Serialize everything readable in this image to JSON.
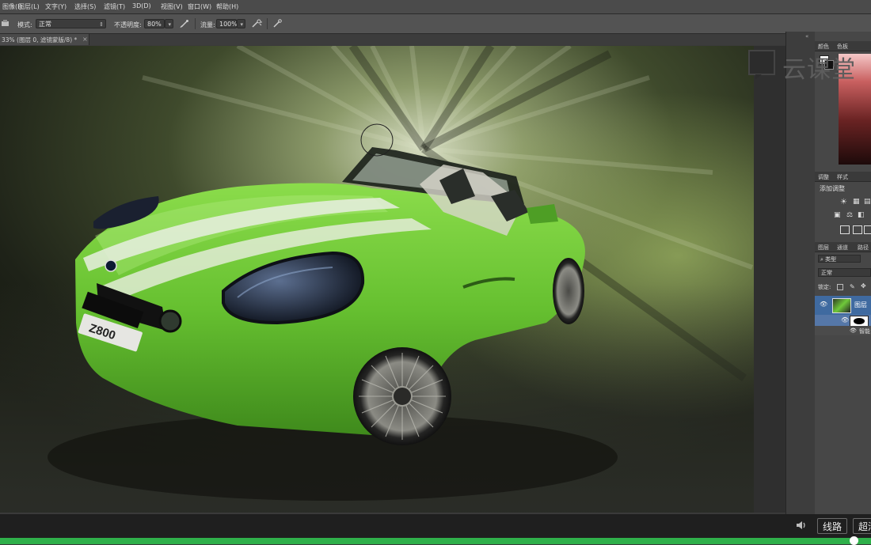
{
  "menu": {
    "items": [
      "图像(I)",
      "图层(L)",
      "文字(Y)",
      "选择(S)",
      "滤镜(T)",
      "3D(D)",
      "视图(V)",
      "窗口(W)",
      "帮助(H)"
    ]
  },
  "options": {
    "mode_label": "模式:",
    "mode_value": "正常",
    "opacity_label": "不透明度:",
    "opacity_value": "80%",
    "flow_label": "流量:",
    "flow_value": "100%"
  },
  "document": {
    "tab_title": "33% (图层 0, 滤镜蒙版/8) *",
    "close": "×"
  },
  "panels": {
    "color_tabs": [
      "颜色",
      "色板"
    ],
    "adjust_tabs": [
      "调整",
      "样式"
    ],
    "adjust_title": "添加调整",
    "layer_tabs": [
      "图层",
      "通道",
      "路径"
    ],
    "filter_kind": "类型",
    "blend_mode": "正常",
    "lock_label": "锁定:",
    "layer_name": "图层",
    "smart_filter": "智能"
  },
  "watermark": {
    "text": "云课堂"
  },
  "video": {
    "line_button": "线路",
    "quality_button": "超清",
    "progress_fraction": 0.98
  },
  "colors": {
    "accent_green": "#2fb04a",
    "car_green": "#6fc93a"
  },
  "icons": {
    "volume": "speaker-icon",
    "brush": "brush-icon",
    "airbrush": "airbrush-icon",
    "visibility": "eye-icon"
  }
}
